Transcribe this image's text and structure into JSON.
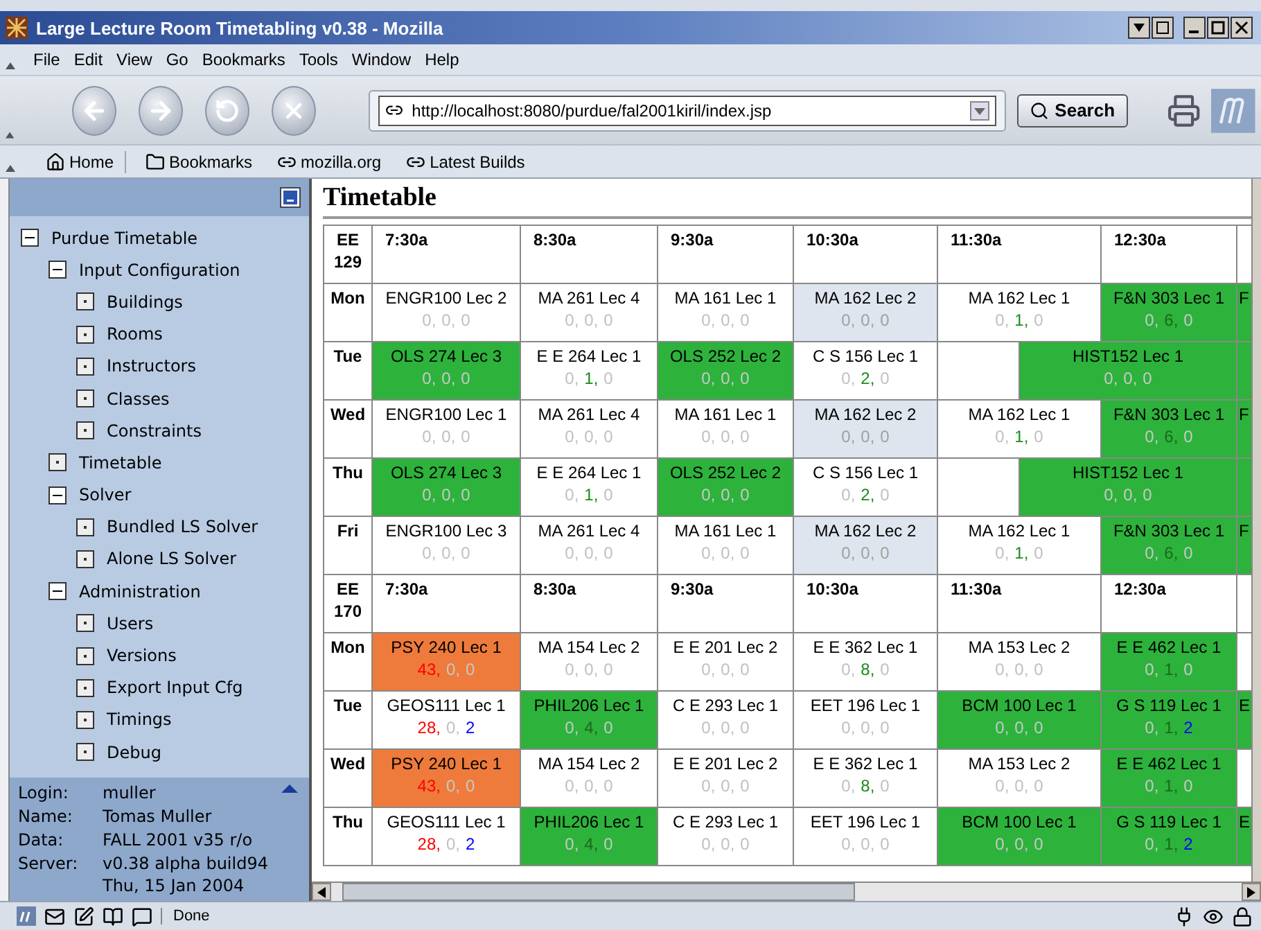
{
  "window": {
    "title": "Large Lecture Room Timetabling v0.38 - Mozilla"
  },
  "menu": [
    "File",
    "Edit",
    "View",
    "Go",
    "Bookmarks",
    "Tools",
    "Window",
    "Help"
  ],
  "navigation": {
    "address": "http://localhost:8080/purdue/fal2001kiril/index.jsp",
    "search_button": "Search"
  },
  "personal_toolbar": [
    {
      "label": "Home",
      "kind": "home"
    },
    {
      "label": "Bookmarks",
      "kind": "folder"
    },
    {
      "label": "mozilla.org",
      "kind": "link"
    },
    {
      "label": "Latest Builds",
      "kind": "link"
    }
  ],
  "sidebar": {
    "tree": [
      {
        "label": "Purdue Timetable",
        "expanded": true,
        "children": [
          {
            "label": "Input Configuration",
            "expanded": true,
            "children": [
              {
                "label": "Buildings"
              },
              {
                "label": "Rooms"
              },
              {
                "label": "Instructors"
              },
              {
                "label": "Classes"
              },
              {
                "label": "Constraints"
              }
            ]
          },
          {
            "label": "Timetable"
          },
          {
            "label": "Solver",
            "expanded": true,
            "children": [
              {
                "label": "Bundled LS Solver"
              },
              {
                "label": "Alone LS Solver"
              }
            ]
          },
          {
            "label": "Administration",
            "expanded": true,
            "children": [
              {
                "label": "Users"
              },
              {
                "label": "Versions"
              },
              {
                "label": "Export Input Cfg"
              },
              {
                "label": "Timings"
              },
              {
                "label": "Debug"
              }
            ]
          }
        ]
      }
    ],
    "info": [
      {
        "label": "Login:",
        "values": [
          "muller"
        ]
      },
      {
        "label": "Name:",
        "values": [
          "Tomas Muller"
        ]
      },
      {
        "label": "Data:",
        "values": [
          "FALL 2001 v35 r/o"
        ]
      },
      {
        "label": "Server:",
        "values": [
          "v0.38 alpha build94",
          "Thu, 15 Jan 2004"
        ]
      }
    ]
  },
  "main": {
    "title": "Timetable",
    "rooms": [
      {
        "name": "EE 129",
        "times": [
          "7:30a",
          "8:30a",
          "9:30a",
          "10:30a",
          "11:30a",
          "12:30a"
        ],
        "days": [
          {
            "day": "Mon",
            "cells": [
              {
                "course": "ENGR100 Lec 2",
                "kind": "plain",
                "scores": [
                  {
                    "value": "0,",
                    "color": "#c0c0c0"
                  },
                  {
                    "value": "0,",
                    "color": "#c0c0c0"
                  },
                  {
                    "value": "0",
                    "color": "#c0c0c0"
                  }
                ]
              },
              {
                "course": "MA 261 Lec 4",
                "kind": "plain",
                "scores": [
                  {
                    "value": "0,",
                    "color": "#c0c0c0"
                  },
                  {
                    "value": "0,",
                    "color": "#c0c0c0"
                  },
                  {
                    "value": "0",
                    "color": "#c0c0c0"
                  }
                ]
              },
              {
                "course": "MA 161 Lec 1",
                "kind": "plain",
                "scores": [
                  {
                    "value": "0,",
                    "color": "#c0c0c0"
                  },
                  {
                    "value": "0,",
                    "color": "#c0c0c0"
                  },
                  {
                    "value": "0",
                    "color": "#c0c0c0"
                  }
                ]
              },
              {
                "course": "MA 162 Lec 2",
                "kind": "shaded",
                "scores": [
                  {
                    "value": "0,",
                    "color": "#a0a0a0"
                  },
                  {
                    "value": "0,",
                    "color": "#a0a0a0"
                  },
                  {
                    "value": "0",
                    "color": "#a0a0a0"
                  }
                ]
              },
              {
                "course": "MA 162 Lec 1",
                "kind": "plain",
                "scores": [
                  {
                    "value": "0,",
                    "color": "#c0c0c0"
                  },
                  {
                    "value": "1,",
                    "color": "#1a8a1a"
                  },
                  {
                    "value": "0",
                    "color": "#c0c0c0"
                  }
                ]
              },
              {
                "course": "F&N 303 Lec 1",
                "kind": "green",
                "scores": [
                  {
                    "value": "0,",
                    "color": "#c8c8c8"
                  },
                  {
                    "value": "6,",
                    "color": "#1a6a1a"
                  },
                  {
                    "value": "0",
                    "color": "#c8c8c8"
                  }
                ]
              },
              {
                "course": "F",
                "kind": "green-sliver"
              }
            ]
          },
          {
            "day": "Tue",
            "cells": [
              {
                "course": "OLS 274 Lec 3",
                "kind": "green",
                "scores": [
                  {
                    "value": "0,",
                    "color": "#c8c8c8"
                  },
                  {
                    "value": "0,",
                    "color": "#c8c8c8"
                  },
                  {
                    "value": "0",
                    "color": "#c8c8c8"
                  }
                ]
              },
              {
                "course": "E E 264 Lec 1",
                "kind": "plain",
                "scores": [
                  {
                    "value": "0,",
                    "color": "#c0c0c0"
                  },
                  {
                    "value": "1,",
                    "color": "#1a8a1a"
                  },
                  {
                    "value": "0",
                    "color": "#c0c0c0"
                  }
                ]
              },
              {
                "course": "OLS 252 Lec 2",
                "kind": "green",
                "scores": [
                  {
                    "value": "0,",
                    "color": "#c8c8c8"
                  },
                  {
                    "value": "0,",
                    "color": "#c8c8c8"
                  },
                  {
                    "value": "0",
                    "color": "#c8c8c8"
                  }
                ]
              },
              {
                "course": "C S 156 Lec 1",
                "kind": "plain",
                "scores": [
                  {
                    "value": "0,",
                    "color": "#c0c0c0"
                  },
                  {
                    "value": "2,",
                    "color": "#1a8a1a"
                  },
                  {
                    "value": "0",
                    "color": "#c0c0c0"
                  }
                ]
              },
              {
                "kind": "gap"
              },
              {
                "course": "HIST152 Lec 1",
                "kind": "green-wide",
                "scores": [
                  {
                    "value": "0,",
                    "color": "#c8c8c8"
                  },
                  {
                    "value": "0,",
                    "color": "#c8c8c8"
                  },
                  {
                    "value": "0",
                    "color": "#c8c8c8"
                  }
                ]
              },
              {
                "kind": "green-sliver"
              }
            ]
          },
          {
            "day": "Wed",
            "cells": [
              {
                "course": "ENGR100 Lec 1",
                "kind": "plain",
                "scores": [
                  {
                    "value": "0,",
                    "color": "#c0c0c0"
                  },
                  {
                    "value": "0,",
                    "color": "#c0c0c0"
                  },
                  {
                    "value": "0",
                    "color": "#c0c0c0"
                  }
                ]
              },
              {
                "course": "MA 261 Lec 4",
                "kind": "plain",
                "scores": [
                  {
                    "value": "0,",
                    "color": "#c0c0c0"
                  },
                  {
                    "value": "0,",
                    "color": "#c0c0c0"
                  },
                  {
                    "value": "0",
                    "color": "#c0c0c0"
                  }
                ]
              },
              {
                "course": "MA 161 Lec 1",
                "kind": "plain",
                "scores": [
                  {
                    "value": "0,",
                    "color": "#c0c0c0"
                  },
                  {
                    "value": "0,",
                    "color": "#c0c0c0"
                  },
                  {
                    "value": "0",
                    "color": "#c0c0c0"
                  }
                ]
              },
              {
                "course": "MA 162 Lec 2",
                "kind": "shaded",
                "scores": [
                  {
                    "value": "0,",
                    "color": "#a0a0a0"
                  },
                  {
                    "value": "0,",
                    "color": "#a0a0a0"
                  },
                  {
                    "value": "0",
                    "color": "#a0a0a0"
                  }
                ]
              },
              {
                "course": "MA 162 Lec 1",
                "kind": "plain",
                "scores": [
                  {
                    "value": "0,",
                    "color": "#c0c0c0"
                  },
                  {
                    "value": "1,",
                    "color": "#1a8a1a"
                  },
                  {
                    "value": "0",
                    "color": "#c0c0c0"
                  }
                ]
              },
              {
                "course": "F&N 303 Lec 1",
                "kind": "green",
                "scores": [
                  {
                    "value": "0,",
                    "color": "#c8c8c8"
                  },
                  {
                    "value": "6,",
                    "color": "#1a6a1a"
                  },
                  {
                    "value": "0",
                    "color": "#c8c8c8"
                  }
                ]
              },
              {
                "course": "F",
                "kind": "green-sliver"
              }
            ]
          },
          {
            "day": "Thu",
            "cells": [
              {
                "course": "OLS 274 Lec 3",
                "kind": "green",
                "scores": [
                  {
                    "value": "0,",
                    "color": "#c8c8c8"
                  },
                  {
                    "value": "0,",
                    "color": "#c8c8c8"
                  },
                  {
                    "value": "0",
                    "color": "#c8c8c8"
                  }
                ]
              },
              {
                "course": "E E 264 Lec 1",
                "kind": "plain",
                "scores": [
                  {
                    "value": "0,",
                    "color": "#c0c0c0"
                  },
                  {
                    "value": "1,",
                    "color": "#1a8a1a"
                  },
                  {
                    "value": "0",
                    "color": "#c0c0c0"
                  }
                ]
              },
              {
                "course": "OLS 252 Lec 2",
                "kind": "green",
                "scores": [
                  {
                    "value": "0,",
                    "color": "#c8c8c8"
                  },
                  {
                    "value": "0,",
                    "color": "#c8c8c8"
                  },
                  {
                    "value": "0",
                    "color": "#c8c8c8"
                  }
                ]
              },
              {
                "course": "C S 156 Lec 1",
                "kind": "plain",
                "scores": [
                  {
                    "value": "0,",
                    "color": "#c0c0c0"
                  },
                  {
                    "value": "2,",
                    "color": "#1a8a1a"
                  },
                  {
                    "value": "0",
                    "color": "#c0c0c0"
                  }
                ]
              },
              {
                "kind": "gap"
              },
              {
                "course": "HIST152 Lec 1",
                "kind": "green-wide",
                "scores": [
                  {
                    "value": "0,",
                    "color": "#c8c8c8"
                  },
                  {
                    "value": "0,",
                    "color": "#c8c8c8"
                  },
                  {
                    "value": "0",
                    "color": "#c8c8c8"
                  }
                ]
              },
              {
                "kind": "green-sliver"
              }
            ]
          },
          {
            "day": "Fri",
            "cells": [
              {
                "course": "ENGR100 Lec 3",
                "kind": "plain",
                "scores": [
                  {
                    "value": "0,",
                    "color": "#c0c0c0"
                  },
                  {
                    "value": "0,",
                    "color": "#c0c0c0"
                  },
                  {
                    "value": "0",
                    "color": "#c0c0c0"
                  }
                ]
              },
              {
                "course": "MA 261 Lec 4",
                "kind": "plain",
                "scores": [
                  {
                    "value": "0,",
                    "color": "#c0c0c0"
                  },
                  {
                    "value": "0,",
                    "color": "#c0c0c0"
                  },
                  {
                    "value": "0",
                    "color": "#c0c0c0"
                  }
                ]
              },
              {
                "course": "MA 161 Lec 1",
                "kind": "plain",
                "scores": [
                  {
                    "value": "0,",
                    "color": "#c0c0c0"
                  },
                  {
                    "value": "0,",
                    "color": "#c0c0c0"
                  },
                  {
                    "value": "0",
                    "color": "#c0c0c0"
                  }
                ]
              },
              {
                "course": "MA 162 Lec 2",
                "kind": "shaded",
                "scores": [
                  {
                    "value": "0,",
                    "color": "#a0a0a0"
                  },
                  {
                    "value": "0,",
                    "color": "#a0a0a0"
                  },
                  {
                    "value": "0",
                    "color": "#a0a0a0"
                  }
                ]
              },
              {
                "course": "MA 162 Lec 1",
                "kind": "plain",
                "scores": [
                  {
                    "value": "0,",
                    "color": "#c0c0c0"
                  },
                  {
                    "value": "1,",
                    "color": "#1a8a1a"
                  },
                  {
                    "value": "0",
                    "color": "#c0c0c0"
                  }
                ]
              },
              {
                "course": "F&N 303 Lec 1",
                "kind": "green",
                "scores": [
                  {
                    "value": "0,",
                    "color": "#c8c8c8"
                  },
                  {
                    "value": "6,",
                    "color": "#1a6a1a"
                  },
                  {
                    "value": "0",
                    "color": "#c8c8c8"
                  }
                ]
              },
              {
                "course": "F",
                "kind": "green-sliver"
              }
            ]
          }
        ]
      },
      {
        "name": "EE 170",
        "times": [
          "7:30a",
          "8:30a",
          "9:30a",
          "10:30a",
          "11:30a",
          "12:30a"
        ],
        "days": [
          {
            "day": "Mon",
            "cells": [
              {
                "course": "PSY 240 Lec 1",
                "kind": "orange",
                "scores": [
                  {
                    "value": "43,",
                    "color": "#ff0000"
                  },
                  {
                    "value": "0,",
                    "color": "#c8c8c8"
                  },
                  {
                    "value": "0",
                    "color": "#c8c8c8"
                  }
                ]
              },
              {
                "course": "MA 154 Lec 2",
                "kind": "plain",
                "scores": [
                  {
                    "value": "0,",
                    "color": "#c0c0c0"
                  },
                  {
                    "value": "0,",
                    "color": "#c0c0c0"
                  },
                  {
                    "value": "0",
                    "color": "#c0c0c0"
                  }
                ]
              },
              {
                "course": "E E 201 Lec 2",
                "kind": "plain",
                "scores": [
                  {
                    "value": "0,",
                    "color": "#c0c0c0"
                  },
                  {
                    "value": "0,",
                    "color": "#c0c0c0"
                  },
                  {
                    "value": "0",
                    "color": "#c0c0c0"
                  }
                ]
              },
              {
                "course": "E E 362 Lec 1",
                "kind": "plain",
                "scores": [
                  {
                    "value": "0,",
                    "color": "#c0c0c0"
                  },
                  {
                    "value": "8,",
                    "color": "#1a8a1a"
                  },
                  {
                    "value": "0",
                    "color": "#c0c0c0"
                  }
                ]
              },
              {
                "course": "MA 153 Lec 2",
                "kind": "plain",
                "scores": [
                  {
                    "value": "0,",
                    "color": "#c0c0c0"
                  },
                  {
                    "value": "0,",
                    "color": "#c0c0c0"
                  },
                  {
                    "value": "0",
                    "color": "#c0c0c0"
                  }
                ]
              },
              {
                "course": "E E 462 Lec 1",
                "kind": "green",
                "scores": [
                  {
                    "value": "0,",
                    "color": "#c8c8c8"
                  },
                  {
                    "value": "1,",
                    "color": "#1a6a1a"
                  },
                  {
                    "value": "0",
                    "color": "#c8c8c8"
                  }
                ]
              },
              {
                "kind": "plain-sliver"
              }
            ]
          },
          {
            "day": "Tue",
            "cells": [
              {
                "course": "GEOS111 Lec 1",
                "kind": "plain",
                "scores": [
                  {
                    "value": "28,",
                    "color": "#ff0000"
                  },
                  {
                    "value": "0,",
                    "color": "#c0c0c0"
                  },
                  {
                    "value": "2",
                    "color": "#0000ff"
                  }
                ]
              },
              {
                "course": "PHIL206 Lec 1",
                "kind": "green",
                "scores": [
                  {
                    "value": "0,",
                    "color": "#c8c8c8"
                  },
                  {
                    "value": "4,",
                    "color": "#1a6a1a"
                  },
                  {
                    "value": "0",
                    "color": "#c8c8c8"
                  }
                ]
              },
              {
                "course": "C E 293 Lec 1",
                "kind": "plain",
                "scores": [
                  {
                    "value": "0,",
                    "color": "#c0c0c0"
                  },
                  {
                    "value": "0,",
                    "color": "#c0c0c0"
                  },
                  {
                    "value": "0",
                    "color": "#c0c0c0"
                  }
                ]
              },
              {
                "course": "EET 196 Lec 1",
                "kind": "plain",
                "scores": [
                  {
                    "value": "0,",
                    "color": "#c0c0c0"
                  },
                  {
                    "value": "0,",
                    "color": "#c0c0c0"
                  },
                  {
                    "value": "0",
                    "color": "#c0c0c0"
                  }
                ]
              },
              {
                "course": "BCM 100 Lec 1",
                "kind": "green",
                "scores": [
                  {
                    "value": "0,",
                    "color": "#c8c8c8"
                  },
                  {
                    "value": "0,",
                    "color": "#c8c8c8"
                  },
                  {
                    "value": "0",
                    "color": "#c8c8c8"
                  }
                ]
              },
              {
                "course": "G S 119 Lec 1",
                "kind": "green",
                "scores": [
                  {
                    "value": "0,",
                    "color": "#c8c8c8"
                  },
                  {
                    "value": "1,",
                    "color": "#1a6a1a"
                  },
                  {
                    "value": "2",
                    "color": "#0000ff"
                  }
                ]
              },
              {
                "course": "E",
                "kind": "green-sliver"
              }
            ]
          },
          {
            "day": "Wed",
            "cells": [
              {
                "course": "PSY 240 Lec 1",
                "kind": "orange",
                "scores": [
                  {
                    "value": "43,",
                    "color": "#ff0000"
                  },
                  {
                    "value": "0,",
                    "color": "#c8c8c8"
                  },
                  {
                    "value": "0",
                    "color": "#c8c8c8"
                  }
                ]
              },
              {
                "course": "MA 154 Lec 2",
                "kind": "plain",
                "scores": [
                  {
                    "value": "0,",
                    "color": "#c0c0c0"
                  },
                  {
                    "value": "0,",
                    "color": "#c0c0c0"
                  },
                  {
                    "value": "0",
                    "color": "#c0c0c0"
                  }
                ]
              },
              {
                "course": "E E 201 Lec 2",
                "kind": "plain",
                "scores": [
                  {
                    "value": "0,",
                    "color": "#c0c0c0"
                  },
                  {
                    "value": "0,",
                    "color": "#c0c0c0"
                  },
                  {
                    "value": "0",
                    "color": "#c0c0c0"
                  }
                ]
              },
              {
                "course": "E E 362 Lec 1",
                "kind": "plain",
                "scores": [
                  {
                    "value": "0,",
                    "color": "#c0c0c0"
                  },
                  {
                    "value": "8,",
                    "color": "#1a8a1a"
                  },
                  {
                    "value": "0",
                    "color": "#c0c0c0"
                  }
                ]
              },
              {
                "course": "MA 153 Lec 2",
                "kind": "plain",
                "scores": [
                  {
                    "value": "0,",
                    "color": "#c0c0c0"
                  },
                  {
                    "value": "0,",
                    "color": "#c0c0c0"
                  },
                  {
                    "value": "0",
                    "color": "#c0c0c0"
                  }
                ]
              },
              {
                "course": "E E 462 Lec 1",
                "kind": "green",
                "scores": [
                  {
                    "value": "0,",
                    "color": "#c8c8c8"
                  },
                  {
                    "value": "1,",
                    "color": "#1a6a1a"
                  },
                  {
                    "value": "0",
                    "color": "#c8c8c8"
                  }
                ]
              },
              {
                "kind": "plain-sliver"
              }
            ]
          },
          {
            "day": "Thu",
            "cells": [
              {
                "course": "GEOS111 Lec 1",
                "kind": "plain",
                "scores": [
                  {
                    "value": "28,",
                    "color": "#ff0000"
                  },
                  {
                    "value": "0,",
                    "color": "#c0c0c0"
                  },
                  {
                    "value": "2",
                    "color": "#0000ff"
                  }
                ]
              },
              {
                "course": "PHIL206 Lec 1",
                "kind": "green",
                "scores": [
                  {
                    "value": "0,",
                    "color": "#c8c8c8"
                  },
                  {
                    "value": "4,",
                    "color": "#1a6a1a"
                  },
                  {
                    "value": "0",
                    "color": "#c8c8c8"
                  }
                ]
              },
              {
                "course": "C E 293 Lec 1",
                "kind": "plain",
                "scores": [
                  {
                    "value": "0,",
                    "color": "#c0c0c0"
                  },
                  {
                    "value": "0,",
                    "color": "#c0c0c0"
                  },
                  {
                    "value": "0",
                    "color": "#c0c0c0"
                  }
                ]
              },
              {
                "course": "EET 196 Lec 1",
                "kind": "plain",
                "scores": [
                  {
                    "value": "0,",
                    "color": "#c0c0c0"
                  },
                  {
                    "value": "0,",
                    "color": "#c0c0c0"
                  },
                  {
                    "value": "0",
                    "color": "#c0c0c0"
                  }
                ]
              },
              {
                "course": "BCM 100 Lec 1",
                "kind": "green",
                "scores": [
                  {
                    "value": "0,",
                    "color": "#c8c8c8"
                  },
                  {
                    "value": "0,",
                    "color": "#c8c8c8"
                  },
                  {
                    "value": "0",
                    "color": "#c8c8c8"
                  }
                ]
              },
              {
                "course": "G S 119 Lec 1",
                "kind": "green",
                "scores": [
                  {
                    "value": "0,",
                    "color": "#c8c8c8"
                  },
                  {
                    "value": "1,",
                    "color": "#1a6a1a"
                  },
                  {
                    "value": "2",
                    "color": "#0000ff"
                  }
                ]
              },
              {
                "course": "E",
                "kind": "green-sliver"
              }
            ]
          }
        ]
      }
    ]
  },
  "status_bar": {
    "text": "Done"
  }
}
